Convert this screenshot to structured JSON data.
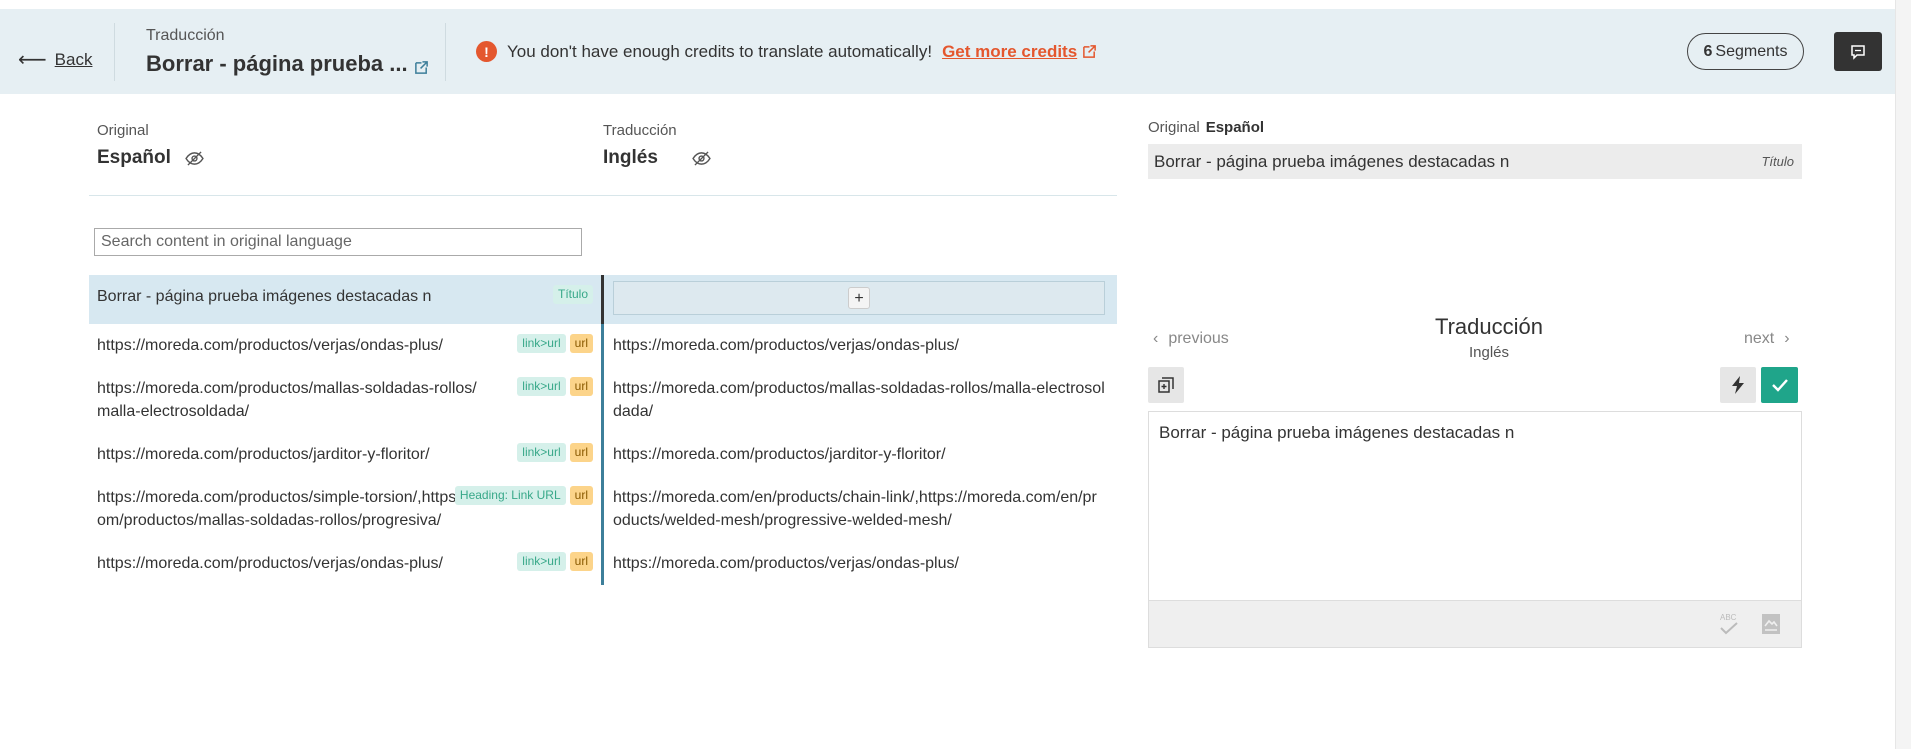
{
  "header": {
    "back_label": "Back",
    "subtitle": "Traducción",
    "title": "Borrar - página prueba ...",
    "alert_text": "You don't have enough credits to translate automatically!",
    "alert_link": "Get more credits",
    "segments_count": "6",
    "segments_label": "Segments"
  },
  "columns": {
    "original_label": "Original",
    "original_lang": "Español",
    "translation_label": "Traducción",
    "translation_lang": "Inglés"
  },
  "search": {
    "placeholder": "Search content in original language"
  },
  "rows": [
    {
      "original": "Borrar - página prueba imágenes destacadas n",
      "tags": [
        {
          "text": "Título",
          "style": "green"
        }
      ],
      "translation": "",
      "active": true
    },
    {
      "original": "https://moreda.com/productos/verjas/ondas-plus/",
      "tags": [
        {
          "text": "link>url",
          "style": "green"
        },
        {
          "text": "url",
          "style": "yellow"
        }
      ],
      "translation": "https://moreda.com/productos/verjas/ondas-plus/"
    },
    {
      "original": "https://moreda.com/productos/mallas-soldadas-rollos/malla-electrosoldada/",
      "tags": [
        {
          "text": "link>url",
          "style": "green"
        },
        {
          "text": "url",
          "style": "yellow"
        }
      ],
      "translation": "https://moreda.com/productos/mallas-soldadas-rollos/malla-electrosoldada/"
    },
    {
      "original": "https://moreda.com/productos/jarditor-y-floritor/",
      "tags": [
        {
          "text": "link>url",
          "style": "green"
        },
        {
          "text": "url",
          "style": "yellow"
        }
      ],
      "translation": "https://moreda.com/productos/jarditor-y-floritor/"
    },
    {
      "original": "https://moreda.com/productos/simple-torsion/,https://moreda.com/productos/mallas-soldadas-rollos/progresiva/",
      "tags": [
        {
          "text": "Heading: Link URL",
          "style": "green"
        },
        {
          "text": "url",
          "style": "yellow"
        }
      ],
      "translation": "https://moreda.com/en/products/chain-link/,https://moreda.com/en/products/welded-mesh/progressive-welded-mesh/"
    },
    {
      "original": "https://moreda.com/productos/verjas/ondas-plus/",
      "tags": [
        {
          "text": "link>url",
          "style": "green"
        },
        {
          "text": "url",
          "style": "yellow"
        }
      ],
      "translation": "https://moreda.com/productos/verjas/ondas-plus/"
    }
  ],
  "panel": {
    "original_label": "Original",
    "original_lang": "Español",
    "original_text": "Borrar - página prueba imágenes destacadas n",
    "original_tag": "Título",
    "previous_label": "previous",
    "next_label": "next",
    "title": "Traducción",
    "lang": "Inglés",
    "editor_value": "Borrar - página prueba imágenes destacadas n",
    "spell_label": "ABC"
  },
  "colors": {
    "header_bg": "#e6eff3",
    "alert": "#e4572e",
    "accent_teal": "#1fa58a",
    "active_row": "#d7e8f1"
  }
}
